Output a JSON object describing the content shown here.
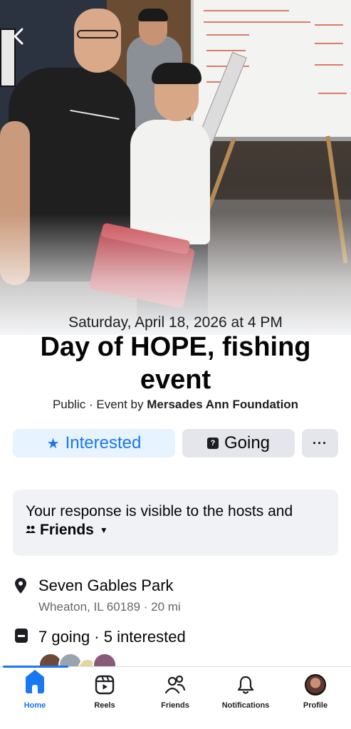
{
  "event": {
    "date": "Saturday, April 18, 2026 at 4 PM",
    "title": "Day of HOPE, fishing event",
    "visibility": "Public",
    "meta_separator": " · Event by ",
    "host": "Mersades Ann Foundation"
  },
  "actions": {
    "interested_label": "Interested",
    "going_label": "Going",
    "more_label": "···"
  },
  "notice": {
    "text": "Your response is visible to the hosts and",
    "audience": "Friends"
  },
  "location": {
    "name": "Seven Gables Park",
    "detail": "Wheaton, IL 60189 · 20 mi"
  },
  "attendance": {
    "summary": "7 going · 5 interested"
  },
  "tabbar": {
    "home": "Home",
    "reels": "Reels",
    "friends": "Friends",
    "notifications": "Notifications",
    "profile": "Profile"
  },
  "icons": {
    "back": "chevron-left-icon",
    "interested": "star-icon",
    "going": "calendar-check-icon",
    "friends_audience": "people-icon",
    "location": "map-pin-icon",
    "attendance": "calendar-icon"
  },
  "colors": {
    "accent": "#1877f2",
    "interested_bg": "#e7f3ff",
    "neutral_btn_bg": "#e4e6eb",
    "secondary_text": "#65676b"
  }
}
